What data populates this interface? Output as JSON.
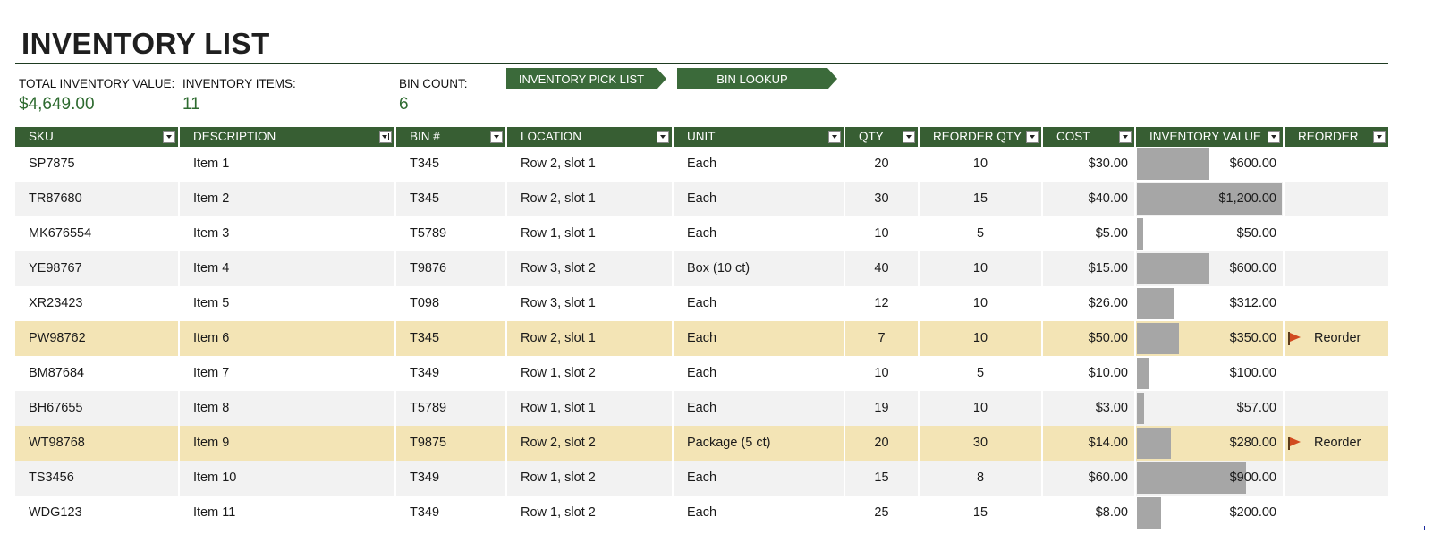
{
  "title": "INVENTORY LIST",
  "summary": {
    "total_value_label": "TOTAL INVENTORY VALUE:",
    "total_value": "$4,649.00",
    "items_label": "INVENTORY ITEMS:",
    "items": "11",
    "bin_label": "BIN COUNT:",
    "bin": "6"
  },
  "nav": {
    "pick_list": "INVENTORY PICK LIST",
    "bin_lookup": "BIN LOOKUP"
  },
  "colors": {
    "header_bg": "#375e33",
    "accent_green": "#2e6b30",
    "reorder_row": "#f3e4b5",
    "alt_row": "#f2f2f2",
    "bar": "#a6a6a6",
    "flag": "#d14a1f"
  },
  "icons": {
    "filter": "filter-dropdown-icon",
    "sorted_filter": "sort-filter-icon",
    "flag": "flag-icon"
  },
  "columns": [
    "SKU",
    "DESCRIPTION",
    "BIN #",
    "LOCATION",
    "UNIT",
    "QTY",
    "REORDER QTY",
    "COST",
    "INVENTORY VALUE",
    "REORDER"
  ],
  "inventory_value_max": 1200,
  "rows": [
    {
      "sku": "SP7875",
      "desc": "Item 1",
      "bin": "T345",
      "loc": "Row 2, slot 1",
      "unit": "Each",
      "qty": "20",
      "reorder_qty": "10",
      "cost": "$30.00",
      "value": "$600.00",
      "value_num": 600,
      "reorder": ""
    },
    {
      "sku": "TR87680",
      "desc": "Item 2",
      "bin": "T345",
      "loc": "Row 2, slot 1",
      "unit": "Each",
      "qty": "30",
      "reorder_qty": "15",
      "cost": "$40.00",
      "value": "$1,200.00",
      "value_num": 1200,
      "reorder": ""
    },
    {
      "sku": "MK676554",
      "desc": "Item 3",
      "bin": "T5789",
      "loc": "Row 1, slot 1",
      "unit": "Each",
      "qty": "10",
      "reorder_qty": "5",
      "cost": "$5.00",
      "value": "$50.00",
      "value_num": 50,
      "reorder": ""
    },
    {
      "sku": "YE98767",
      "desc": "Item 4",
      "bin": "T9876",
      "loc": "Row 3, slot 2",
      "unit": "Box (10 ct)",
      "qty": "40",
      "reorder_qty": "10",
      "cost": "$15.00",
      "value": "$600.00",
      "value_num": 600,
      "reorder": ""
    },
    {
      "sku": "XR23423",
      "desc": "Item 5",
      "bin": "T098",
      "loc": "Row 3, slot 1",
      "unit": "Each",
      "qty": "12",
      "reorder_qty": "10",
      "cost": "$26.00",
      "value": "$312.00",
      "value_num": 312,
      "reorder": ""
    },
    {
      "sku": "PW98762",
      "desc": "Item 6",
      "bin": "T345",
      "loc": "Row 2, slot 1",
      "unit": "Each",
      "qty": "7",
      "reorder_qty": "10",
      "cost": "$50.00",
      "value": "$350.00",
      "value_num": 350,
      "reorder": "Reorder"
    },
    {
      "sku": "BM87684",
      "desc": "Item 7",
      "bin": "T349",
      "loc": "Row 1, slot 2",
      "unit": "Each",
      "qty": "10",
      "reorder_qty": "5",
      "cost": "$10.00",
      "value": "$100.00",
      "value_num": 100,
      "reorder": ""
    },
    {
      "sku": "BH67655",
      "desc": "Item 8",
      "bin": "T5789",
      "loc": "Row 1, slot 1",
      "unit": "Each",
      "qty": "19",
      "reorder_qty": "10",
      "cost": "$3.00",
      "value": "$57.00",
      "value_num": 57,
      "reorder": ""
    },
    {
      "sku": "WT98768",
      "desc": "Item 9",
      "bin": "T9875",
      "loc": "Row 2, slot 2",
      "unit": "Package (5 ct)",
      "qty": "20",
      "reorder_qty": "30",
      "cost": "$14.00",
      "value": "$280.00",
      "value_num": 280,
      "reorder": "Reorder"
    },
    {
      "sku": "TS3456",
      "desc": "Item 10",
      "bin": "T349",
      "loc": "Row 1, slot 2",
      "unit": "Each",
      "qty": "15",
      "reorder_qty": "8",
      "cost": "$60.00",
      "value": "$900.00",
      "value_num": 900,
      "reorder": ""
    },
    {
      "sku": "WDG123",
      "desc": "Item 11",
      "bin": "T349",
      "loc": "Row 1, slot 2",
      "unit": "Each",
      "qty": "25",
      "reorder_qty": "15",
      "cost": "$8.00",
      "value": "$200.00",
      "value_num": 200,
      "reorder": ""
    }
  ]
}
